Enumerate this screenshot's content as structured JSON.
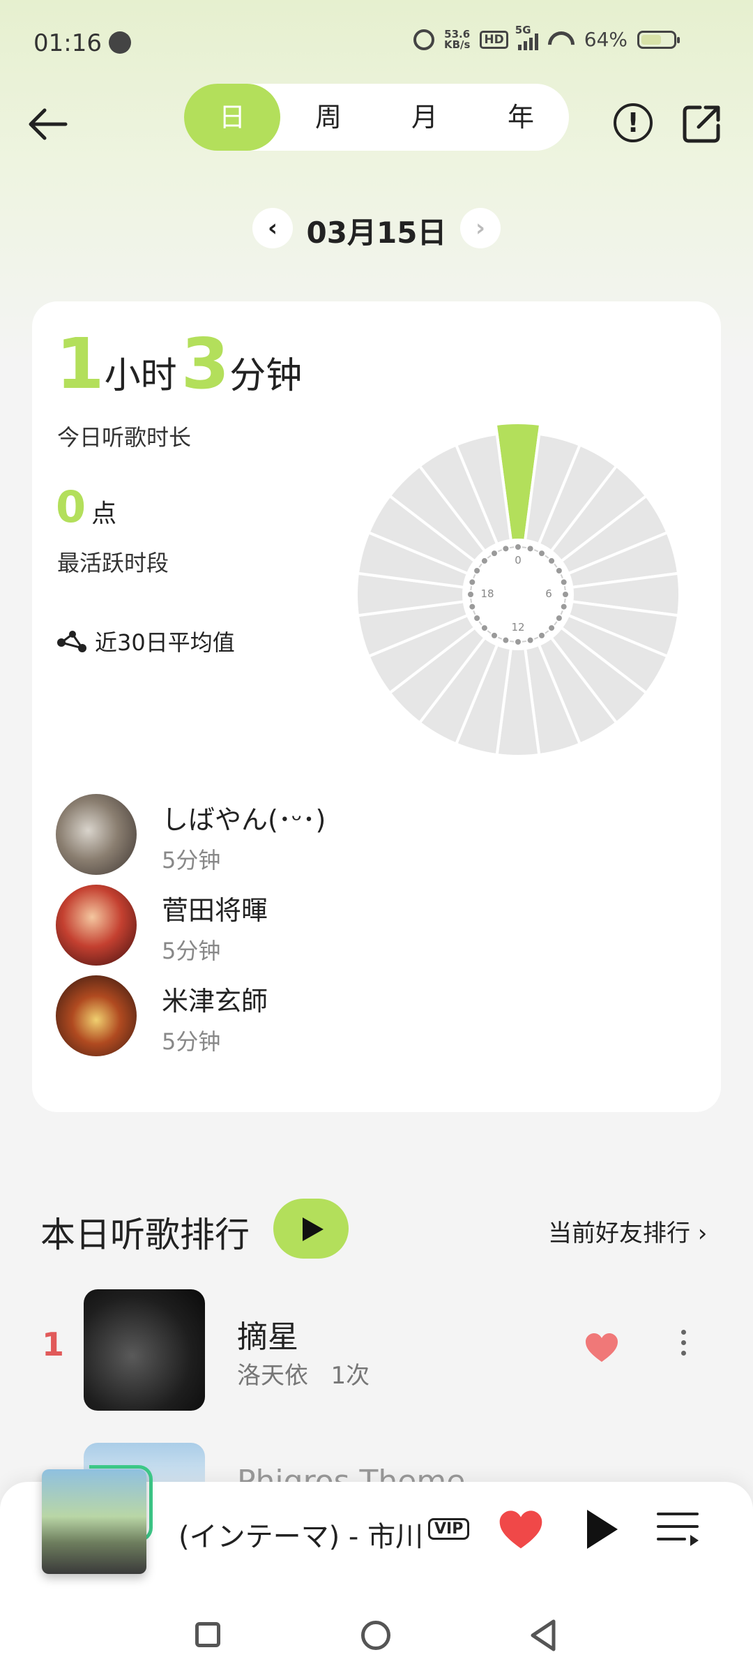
{
  "status_bar": {
    "time": "01:16",
    "net_speed_value": "53.6",
    "net_speed_unit": "KB/s",
    "hd": "HD",
    "network": "5G",
    "battery": "64%",
    "battery_level": 0.64
  },
  "header": {
    "tabs": [
      "日",
      "周",
      "月",
      "年"
    ],
    "active_tab": "日"
  },
  "date_nav": {
    "prev": "‹",
    "date": "03月15日",
    "next": "›"
  },
  "summary": {
    "hours": "1",
    "hours_unit": "小时",
    "minutes": "3",
    "minutes_unit": "分钟",
    "duration_label": "今日听歌时长",
    "peak_hour": "0",
    "peak_unit": "点",
    "peak_label": "最活跃时段",
    "avg_label": "近30日平均值"
  },
  "clock_chart": {
    "labels": [
      "0",
      "6",
      "12",
      "18"
    ],
    "active_hour": 0,
    "accent": "#b3df5b",
    "inactive": "#e6e6e6"
  },
  "top_artists": [
    {
      "name": "しばやん(･ᵕ･)",
      "time": "5分钟"
    },
    {
      "name": "菅田将暉",
      "time": "5分钟"
    },
    {
      "name": "米津玄師",
      "time": "5分钟"
    }
  ],
  "ranking": {
    "title": "本日听歌排行",
    "friends_link": "当前好友排行 ›",
    "songs": [
      {
        "rank": "1",
        "title": "摘星",
        "artist": "洛天依",
        "plays": "1次"
      },
      {
        "title": "Phigros Theme"
      }
    ]
  },
  "player": {
    "title": "(インテーマ) - 市川淳",
    "vip": "VIP"
  },
  "colors": {
    "accent": "#b3df5b",
    "rank_red": "#e15a5a",
    "heart": "#f05050"
  }
}
